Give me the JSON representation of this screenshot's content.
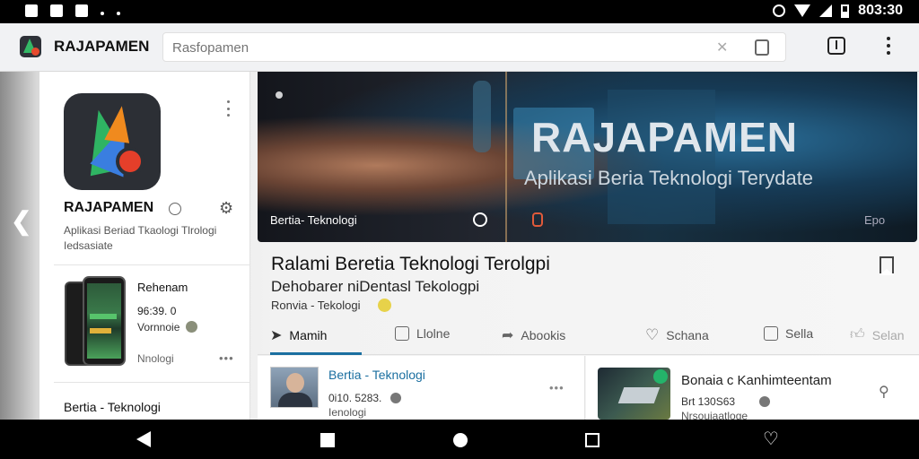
{
  "status_bar": {
    "time": "803:30"
  },
  "app_bar": {
    "title": "RAJAPAMEN",
    "search_placeholder": "Rasfopamen",
    "clear_icon": "close-icon",
    "share_icon": "share-icon",
    "more_icon": "more-vert-icon"
  },
  "left_panel": {
    "app_name": "RAJAPAMEN",
    "app_desc": "Aplikasi Beriad Tkaologi Tlrologi Iedsasiate",
    "card": {
      "title": "Rehenam",
      "number": "96:39. 0",
      "sub": "Vornnoie",
      "tag": "Nnologi",
      "more": "•••"
    },
    "bottom_label": "Bertia - Teknologi"
  },
  "hero": {
    "title": "RAJAPAMEN",
    "subtitle": "Aplikasi Beria Teknologi Terydate",
    "tag": "Bertia- Teknologi",
    "right_tag": "Epo"
  },
  "article": {
    "title": "Ralami Beretia Teknologi Terolgpi",
    "subtitle": "Dehobarer niDentasl Tekologpi",
    "meta": "Ronvia - Tekologi"
  },
  "tabs": [
    {
      "label": "Mamih",
      "icon": "send-icon"
    },
    {
      "label": "Llolne",
      "icon": "comment-icon"
    },
    {
      "label": "Abookis",
      "icon": "share-arrow-icon"
    },
    {
      "label": "Schana",
      "icon": "heart-icon"
    },
    {
      "label": "Sella",
      "icon": "bookmark-icon"
    },
    {
      "label": "Selan",
      "icon": "thumb-up-icon"
    }
  ],
  "feed": [
    {
      "title": "Bertia - Teknologi",
      "number": "0i10. 5283.",
      "sub": "Ienologi",
      "more": "•••"
    },
    {
      "title": "Bonaia c Kanhimteentam",
      "number": "Brt 130S63",
      "sub": "Nrsouiaatloge"
    }
  ],
  "colors": {
    "accent": "#1b6fa0",
    "status_bar": "#000000",
    "app_bar": "#f1f2f4"
  }
}
